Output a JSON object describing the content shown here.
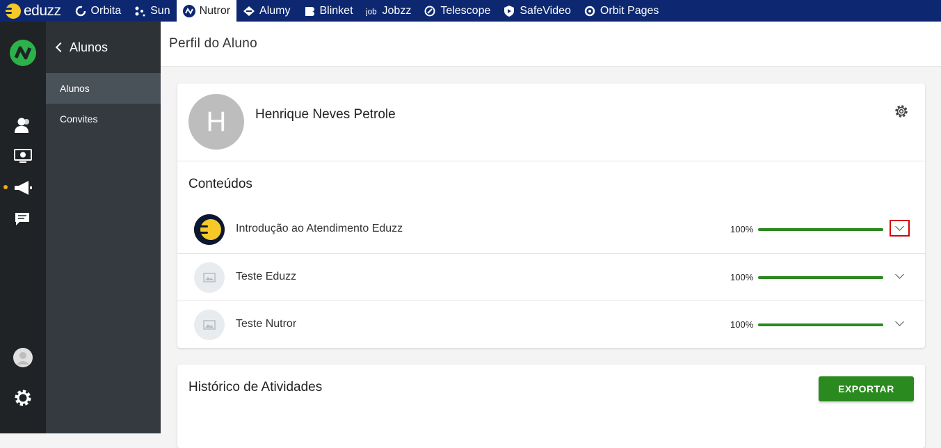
{
  "topbar": {
    "brand": "eduzz",
    "apps": [
      {
        "label": "Orbita",
        "icon": "orbita-icon"
      },
      {
        "label": "Sun",
        "icon": "sun-icon"
      },
      {
        "label": "Nutror",
        "icon": "nutror-icon",
        "active": true
      },
      {
        "label": "Alumy",
        "icon": "alumy-icon"
      },
      {
        "label": "Blinket",
        "icon": "blinket-icon"
      },
      {
        "label": "Jobzz",
        "icon": "jobzz-icon"
      },
      {
        "label": "Telescope",
        "icon": "telescope-icon"
      },
      {
        "label": "SafeVideo",
        "icon": "safevideo-icon"
      },
      {
        "label": "Orbit Pages",
        "icon": "orbit-pages-icon"
      }
    ]
  },
  "sidebar": {
    "back_label": "Alunos",
    "items": [
      {
        "label": "Alunos",
        "active": true
      },
      {
        "label": "Convites",
        "active": false
      }
    ]
  },
  "header": {
    "title": "Perfil do Aluno"
  },
  "profile": {
    "initial": "H",
    "name": "Henrique Neves Petrole"
  },
  "contents": {
    "title": "Conteúdos",
    "items": [
      {
        "title": "Introdução ao Atendimento Eduzz",
        "progress_label": "100%",
        "progress": 1.0,
        "thumb": "eduzz-logo"
      },
      {
        "title": "Teste Eduzz",
        "progress_label": "100%",
        "progress": 1.0,
        "thumb": "image-placeholder-icon"
      },
      {
        "title": "Teste Nutror",
        "progress_label": "100%",
        "progress": 1.0,
        "thumb": "image-placeholder-icon"
      }
    ]
  },
  "history": {
    "title": "Histórico de Atividades",
    "export_label": "EXPORTAR"
  },
  "colors": {
    "topbar": "#0d2871",
    "accent_green": "#2a8a1f",
    "rail": "#1f2326",
    "sidebar": "#343a40"
  }
}
